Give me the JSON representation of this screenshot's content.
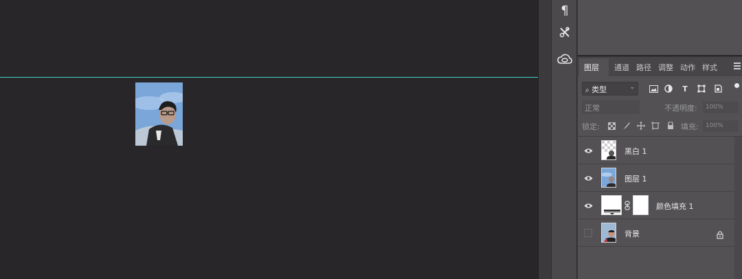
{
  "top_tools": [
    {
      "icon": "paragraph-icon",
      "glyph": "¶"
    },
    {
      "icon": "tools-icon",
      "glyph": "✂"
    },
    {
      "icon": "creative-cloud-icon",
      "glyph": "⊛"
    }
  ],
  "layers_panel": {
    "tabs": [
      "图层",
      "通道",
      "路径",
      "调整",
      "动作",
      "样式"
    ],
    "active_tab": "图层",
    "filter": {
      "label": "类型",
      "prefix_icon": "search-icon"
    },
    "blend_mode": "正常",
    "opacity_label": "不透明度:",
    "opacity_value": "100%",
    "lock_label": "锁定:",
    "fill_label": "填充:",
    "fill_value": "100%",
    "layers": [
      {
        "name": "黑白 1",
        "visible": true,
        "thumbnail": "black-white-adjustment"
      },
      {
        "name": "图层 1",
        "visible": true,
        "thumbnail": "photo"
      },
      {
        "name": "颜色填充 1",
        "visible": true,
        "thumbnail": "color-fill-with-mask"
      },
      {
        "name": "背景",
        "visible": false,
        "thumbnail": "background-photo",
        "locked": true
      }
    ]
  },
  "colors": {
    "guide_line": "#3fd3c8",
    "canvas_bg": "#282628",
    "panel_bg": "#535154"
  }
}
